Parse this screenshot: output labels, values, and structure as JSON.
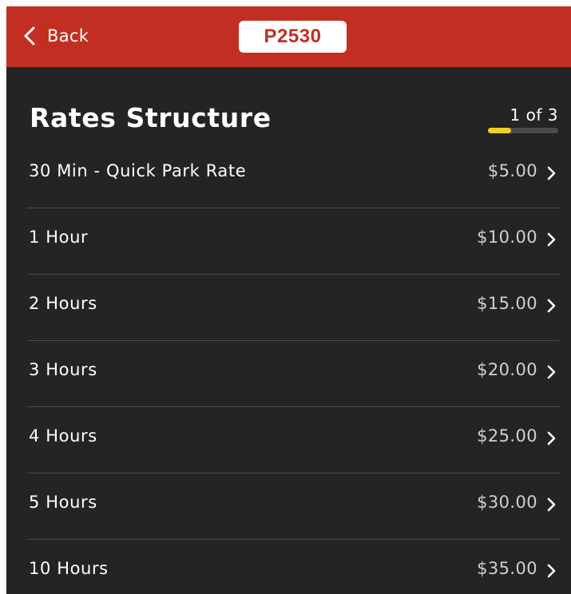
{
  "header": {
    "back_label": "Back",
    "lot_id": "P2530",
    "background_color": "#c22f22"
  },
  "section": {
    "title": "Rates Structure",
    "page_indicator": "1 of 3",
    "progress_fraction": 0.333,
    "progress_color": "#f2d020"
  },
  "rates": [
    {
      "label": "30 Min - Quick Park Rate",
      "price": "$5.00"
    },
    {
      "label": "1 Hour",
      "price": "$10.00"
    },
    {
      "label": "2 Hours",
      "price": "$15.00"
    },
    {
      "label": "3 Hours",
      "price": "$20.00"
    },
    {
      "label": "4 Hours",
      "price": "$25.00"
    },
    {
      "label": "5 Hours",
      "price": "$30.00"
    },
    {
      "label": "10 Hours",
      "price": "$35.00"
    }
  ],
  "icons": {
    "back": "chevron-left-icon",
    "row": "chevron-right-icon"
  }
}
